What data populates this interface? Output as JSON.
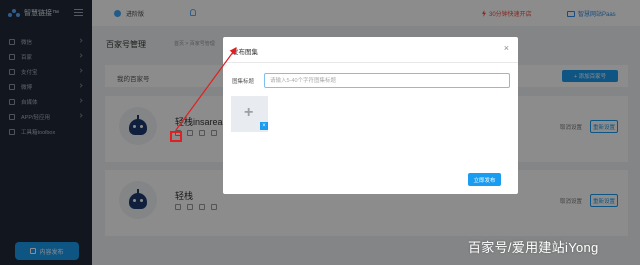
{
  "brand": {
    "name": "智慧链接™"
  },
  "sidebar": {
    "items": [
      {
        "label": "微信"
      },
      {
        "label": "百家"
      },
      {
        "label": "支付宝"
      },
      {
        "label": "微博"
      },
      {
        "label": "自媒体"
      },
      {
        "label": "APP/轻应用"
      },
      {
        "label": "工具箱toolbox"
      }
    ],
    "publish_label": "内容发布"
  },
  "topbar": {
    "edition": "进阶版",
    "fast_open": "30分钟快速开店",
    "paas": "智慧网站Paas"
  },
  "main": {
    "page_title": "百家号管理",
    "breadcrumb": "首页 > 百家号管理",
    "panel_label": "我的百家号",
    "add_button": "+ 添加百家号",
    "accounts": [
      {
        "name": "轻栈insarea",
        "unbind": "取消设置",
        "reset": "重新设置"
      },
      {
        "name": "轻栈",
        "unbind": "取消设置",
        "reset": "重新设置"
      }
    ]
  },
  "modal": {
    "title": "发布图集",
    "close": "×",
    "field_label": "图集标题",
    "field_placeholder": "请输入5-40个字符图集标题",
    "field_value": "",
    "upload_plus": "+",
    "upload_remove": "×",
    "publish_label": "立即发布"
  },
  "watermark": "百家号/爱用建站iYong",
  "colors": {
    "accent": "#1a9cf0",
    "sidebar": "#222b3a",
    "highlight": "#e02020"
  }
}
